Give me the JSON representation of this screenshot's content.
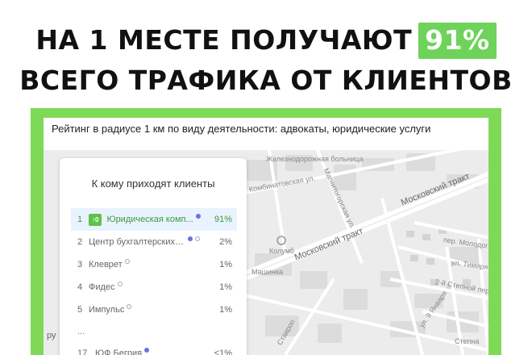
{
  "headline": {
    "line1": "НА 1 МЕСТЕ ПОЛУЧАЮТ",
    "highlight": "91%",
    "line2": "ВСЕГО ТРАФИКА ОТ КЛИЕНТОВ"
  },
  "colors": {
    "frame_green": "#7ed957",
    "highlight_green": "#6dd35a",
    "badge_green": "#5fc24b",
    "active_text": "#3c9a3c",
    "active_row_bg": "#e9f3ff",
    "verify_dot": "#6a72d8"
  },
  "panel": {
    "title": "Рейтинг в радиусе 1 км по виду деятельности: адвокаты, юридические услуги"
  },
  "card": {
    "title": "К кому приходят клиенты",
    "items": [
      {
        "rank": "1",
        "badge": "↑0",
        "name": "Юридическая комп...",
        "percent": "91%",
        "icons": [
          "verified-dot"
        ]
      },
      {
        "rank": "2",
        "name": "Центр бухгалтерских ус...",
        "percent": "2%",
        "icons": [
          "verified-dot",
          "info-dot"
        ]
      },
      {
        "rank": "3",
        "name": "Клеврет",
        "percent": "1%",
        "icons": [
          "info-dot"
        ]
      },
      {
        "rank": "4",
        "name": "Фидес",
        "percent": "1%",
        "icons": [
          "info-dot"
        ]
      },
      {
        "rank": "5",
        "name": "Импульс",
        "percent": "1%",
        "icons": [
          "info-dot"
        ]
      }
    ],
    "more": "...",
    "last_item": {
      "rank": "17",
      "name": "ЮФ Бегрия",
      "percent": "<1%",
      "icons": [
        "verified-dot"
      ]
    }
  },
  "map": {
    "labels": {
      "hospital": "Железнодорожная больница",
      "street_magnitogorsk": "Магнитогорская ул.",
      "street_kombinatov": "Комбинатовская ул.",
      "moskovsky_trakt_upper": "Московский тракт",
      "moskovsky_trakt_lower": "Московский тракт",
      "kolumb": "Колумб",
      "mashinka": "Машинка",
      "per_molodogvard": "пер. Молодогвард",
      "ul_timiryaz": "ул. Тимиряз",
      "stepnoy": "2-й Степной пер.",
      "yanvarya": "ул. 9 Января",
      "stepnaya": "Степна",
      "stavrop": "Ставроп",
      "edge_ru": "ру"
    }
  }
}
